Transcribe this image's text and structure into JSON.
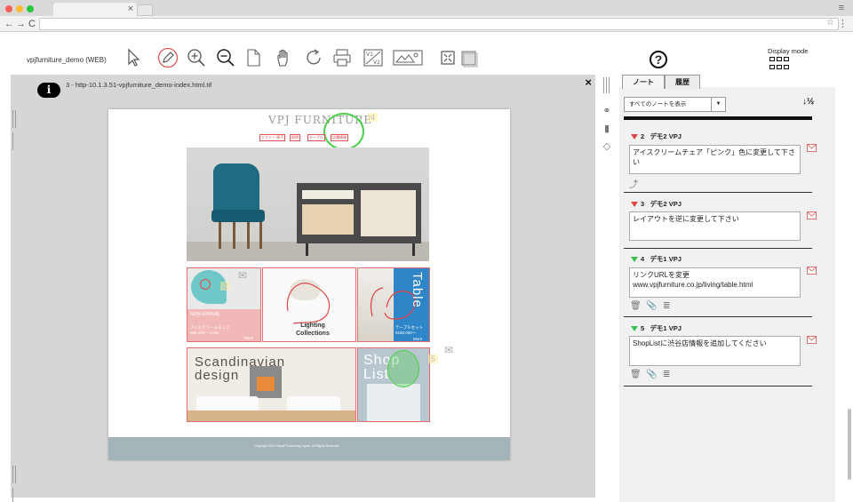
{
  "browser": {
    "tab_close": "×",
    "back": "←",
    "forward": "→",
    "reload": "C",
    "star": "☆",
    "menu": "⋮",
    "profile": "≡"
  },
  "toolbar": {
    "app_title": "vpjfurniture_demo (WEB)",
    "icons": [
      "cursor-icon",
      "pencil-icon",
      "zoom-in-icon",
      "zoom-out-icon",
      "page-icon",
      "hand-icon",
      "rotate-icon",
      "print-icon",
      "compare-icon",
      "image-compare-icon",
      "fit-icon",
      "panel-icon"
    ],
    "help": "?",
    "display_mode_label": "Display mode"
  },
  "viewer": {
    "info_label": "i",
    "title": "3 - http-10.1.3.51-vpjfurniture_demo-index.html.tif",
    "close": "×"
  },
  "doc": {
    "logo": "VPJ FURNITURE",
    "nav": [
      "ソファー 椅子",
      "照明",
      "テーブル",
      "店舗情報"
    ],
    "tile_product_title": "NEW ARRIVAL",
    "tile_product_text": "アイスクリームチェア",
    "tile_product_price": "¥80,000〜  Color",
    "tile_more": "More",
    "lighting_label": "Lighting Collections",
    "table_title": "Table",
    "table_text": "テーブルセット",
    "table_price": "¥150,000〜",
    "table_more": "More",
    "scandi_line1": "Scandinavian",
    "scandi_line2": "design",
    "shop_line1": "Shop",
    "shop_line2": "List",
    "note_tags": [
      "4",
      "2",
      "5"
    ],
    "footer": "Copyright 2016 Visual Processing Japan. All Rights Reserved."
  },
  "panel": {
    "tabs": [
      "ノート",
      "履歴"
    ],
    "filter_value": "すべてのノートを表示",
    "filter_arrow": "▼",
    "sort_label": "↓½",
    "notes": [
      {
        "num": "2",
        "author": "デモ2 VPJ",
        "status": "red",
        "text": "アイスクリームチェア「ピンク」色に変更して下さい"
      },
      {
        "num": "3",
        "author": "デモ2 VPJ",
        "status": "red",
        "text": "レイアウトを逆に変更して下さい"
      },
      {
        "num": "4",
        "author": "デモ1 VPJ",
        "status": "green",
        "text": "リンクURLを変更\nwww.vpjfurniture.co.jp/living/table.html"
      },
      {
        "num": "5",
        "author": "デモ1 VPJ",
        "status": "green",
        "text": "ShopListに渋谷店情報を追加してください"
      }
    ]
  }
}
